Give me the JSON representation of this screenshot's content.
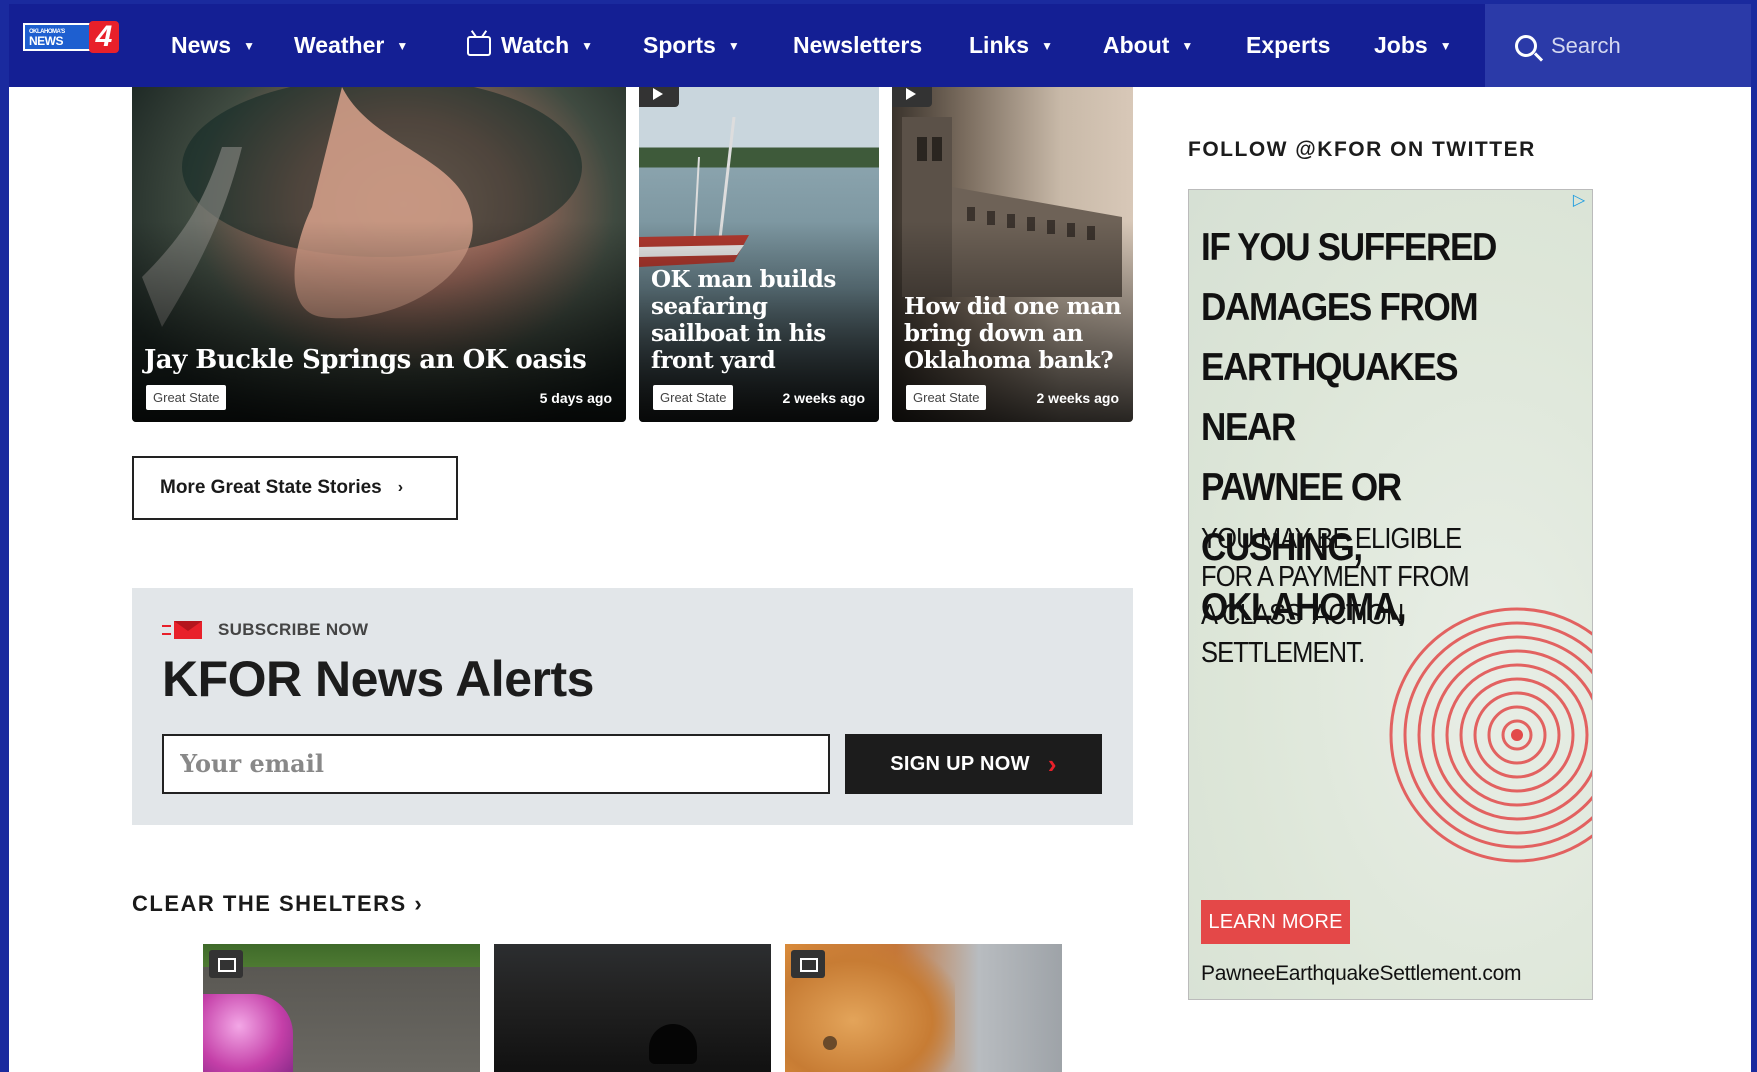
{
  "nav": {
    "logo_alt": "Oklahoma's News 4",
    "logo_small": "OKLAHOMA'S",
    "logo_main": "NEWS",
    "logo_number": "4",
    "items": [
      {
        "label": "News",
        "dropdown": true
      },
      {
        "label": "Weather",
        "dropdown": true
      },
      {
        "label": "Watch",
        "dropdown": true,
        "icon": "tv-icon"
      },
      {
        "label": "Sports",
        "dropdown": true
      },
      {
        "label": "Newsletters",
        "dropdown": false
      },
      {
        "label": "Links",
        "dropdown": true
      },
      {
        "label": "About",
        "dropdown": true
      },
      {
        "label": "Experts",
        "dropdown": false
      },
      {
        "label": "Jobs",
        "dropdown": true
      }
    ],
    "search_placeholder": "Search",
    "colors": {
      "bar": "#141f94",
      "search_bg": "#2b3aa8"
    }
  },
  "stories": [
    {
      "title": "Jay Buckle Springs an OK oasis",
      "tag": "Great State",
      "time": "5 days ago"
    },
    {
      "title": "OK man builds seafaring sailboat in his front yard",
      "tag": "Great State",
      "time": "2 weeks ago",
      "video": true
    },
    {
      "title": "How did one man bring down an Oklahoma bank?",
      "tag": "Great State",
      "time": "2 weeks ago",
      "video": true
    }
  ],
  "more_button": {
    "label": "More Great State Stories",
    "icon": "chevron-right-icon"
  },
  "subscribe": {
    "label": "SUBSCRIBE NOW",
    "title": "KFOR News Alerts",
    "email_placeholder": "Your email",
    "button": "SIGN UP NOW",
    "icon": "mail-icon",
    "accent": "#e8202a"
  },
  "shelters": {
    "heading": "CLEAR THE SHELTERS",
    "heading_chevron": "›"
  },
  "sidebar": {
    "follow": "FOLLOW @KFOR ON TWITTER",
    "ad": {
      "headline_lines": [
        "IF YOU SUFFERED",
        "DAMAGES FROM",
        "EARTHQUAKES NEAR",
        "PAWNEE OR CUSHING,",
        "OKLAHOMA,"
      ],
      "body_lines": [
        "YOU MAY BE ELIGIBLE",
        "FOR A PAYMENT FROM",
        "A CLASS  ACTION",
        "SETTLEMENT."
      ],
      "button": "LEARN MORE",
      "url": "PawneeEarthquakeSettlement.com",
      "ad_choice_icon": "adchoices-icon",
      "accent": "#e44848"
    }
  }
}
